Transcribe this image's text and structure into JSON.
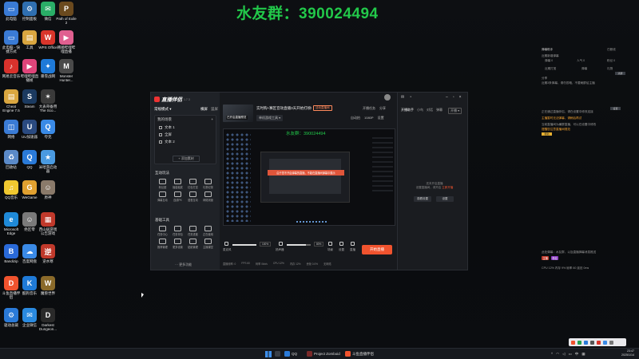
{
  "watermark": "水友群：390024494",
  "desktop_icons": [
    {
      "label": "此电脑",
      "color": "#3a7bd5",
      "glyph": "▭"
    },
    {
      "label": "控制面板",
      "color": "#2f6fb0",
      "glyph": "⚙"
    },
    {
      "label": "微信",
      "color": "#2aae67",
      "glyph": "✉"
    },
    {
      "label": "Path of Exile 2",
      "color": "#6b4a1e",
      "glyph": "P"
    },
    {
      "label": "此电脑 - 快捷方式",
      "color": "#3a7bd5",
      "glyph": "▭"
    },
    {
      "label": "工具",
      "color": "#d9a640",
      "glyph": "▤"
    },
    {
      "label": "WPS Office",
      "color": "#d9352b",
      "glyph": "W"
    },
    {
      "label": "韩顺哔哩哔哩直播",
      "color": "#e06090",
      "glyph": "▶"
    },
    {
      "label": "网易云音乐",
      "color": "#d8322c",
      "glyph": "♪"
    },
    {
      "label": "哔哩哔哩直播姬",
      "color": "#e0457a",
      "glyph": "▶"
    },
    {
      "label": "暴雪战网",
      "color": "#1f7ad8",
      "glyph": "✦"
    },
    {
      "label": "Monster Hunter...",
      "color": "#4a4a4a",
      "glyph": "M"
    },
    {
      "label": "Cheat Engine 7.5",
      "color": "#d9a640",
      "glyph": "▤"
    },
    {
      "label": "Steam",
      "color": "#1b3a60",
      "glyph": "S"
    },
    {
      "label": "大表哥备用The Sco...",
      "color": "#3a3a3a",
      "glyph": "✶"
    },
    {
      "label": "网络",
      "color": "#3a7bd5",
      "glyph": "◫"
    },
    {
      "label": "UU加速器",
      "color": "#2a4a80",
      "glyph": "U"
    },
    {
      "label": "夸克",
      "color": "#3a8ae6",
      "glyph": "Q"
    },
    {
      "label": "回收站",
      "color": "#5b8ac8",
      "glyph": "♻"
    },
    {
      "label": "QQ",
      "color": "#2a7ad8",
      "glyph": "Q"
    },
    {
      "label": "米哈游启动器",
      "color": "#4a9ae0",
      "glyph": "★"
    },
    {
      "label": "QQ音乐",
      "color": "#f0c830",
      "glyph": "♫"
    },
    {
      "label": "WeGame",
      "color": "#e0a030",
      "glyph": "G"
    },
    {
      "label": "原神",
      "color": "#8a7a6a",
      "glyph": "☺"
    },
    {
      "label": "Microsoft Edge",
      "color": "#1f8ad8",
      "glyph": "e"
    },
    {
      "label": "绝区零",
      "color": "#7a7a7a",
      "glyph": "☺"
    },
    {
      "label": "西山居游戏 公告游戏",
      "color": "#c0392b",
      "glyph": "▦"
    },
    {
      "label": "Bandizip",
      "color": "#2a6ad8",
      "glyph": "B"
    },
    {
      "label": "百度网盘",
      "color": "#3a8ae6",
      "glyph": "☁"
    },
    {
      "label": "逆水寒",
      "color": "#c0392b",
      "glyph": "逆"
    },
    {
      "label": "斗鱼直播伴侣",
      "color": "#f0532e",
      "glyph": "D"
    },
    {
      "label": "酷狗音乐",
      "color": "#1f7ad8",
      "glyph": "K"
    },
    {
      "label": "魔兽世界",
      "color": "#8a6a2a",
      "glyph": "W"
    },
    {
      "label": "驱动总裁",
      "color": "#2a7ad8",
      "glyph": "⚙"
    },
    {
      "label": "企业微信",
      "color": "#2a8ae0",
      "glyph": "✉"
    },
    {
      "label": "Darkest Dungeon...",
      "color": "#2a2a2a",
      "glyph": "D"
    }
  ],
  "app": {
    "logo_text": "直播伴侣",
    "version": "1.7.3",
    "mode_label": "常规模式 ▾",
    "mode_tabs": [
      "横屏",
      "竖屏"
    ],
    "scene_header": "我的场景",
    "scenes": [
      "文本 1",
      "全屏",
      "文本 2"
    ],
    "add_source": "+ 添加素材",
    "section_interactive": "互动玩法",
    "interactive_tools": [
      "粉丝团",
      "福袋抽奖",
      "红包打赏",
      "礼物记录",
      "弹幕互动",
      "连线PK",
      "语音互动",
      "网络测速"
    ],
    "section_basic": "基础工具",
    "basic_tools": [
      "任务中心",
      "任务背包",
      "任务进度",
      "正在使用",
      "推荐管理",
      "更多设置",
      "贴纸管理",
      "主播课堂"
    ],
    "more_functions": "··· 更多功能",
    "thumb_caption": "已开启直播预览",
    "stream_title": "实时购+赛区音效直播3天开始打榜!",
    "stream_tag": "活动直播间",
    "category": "单机游戏工具 ▾",
    "top_actions": [
      "开播任务",
      "分享"
    ],
    "top_actions2": [
      "自动拍",
      "1080P",
      "设置"
    ],
    "preview_watermark": "水友群：390024494",
    "preview_banner": "由于您不开启弹幕的直播，不能在直播间弹幕中展示",
    "control_labels": [
      "麦克风",
      "扬声器",
      "场景",
      "设置",
      "直播"
    ],
    "mic_pct": "100%",
    "speaker_pct": "80%",
    "start_live": "开始直播",
    "status_items": [
      "直播帧率: 0",
      "FPS 60",
      "码率 0kb/s",
      "CPU 12%",
      "内存 12%",
      "丢帧 0.0%",
      "无网络"
    ],
    "side_tabs": [
      "开播助手",
      "小鸟",
      "对话",
      "弹幕"
    ],
    "side_pill": "开播 ▾",
    "side_empty_line1": "还未开启直播",
    "side_empty_line2": "设置直播间，请开启",
    "side_empty_link": "立即开播",
    "side_buttons": [
      "观看设置",
      "设置"
    ]
  },
  "overlay": {
    "head": "弹幕助手",
    "head_right": "已断线",
    "lines": [
      "近期新增弹幕",
      "弹幕 0",
      "人气 0",
      "粉丝 0",
      "近期打赏",
      "弹幕",
      "礼物",
      "分享",
      "近期3条弹幕，请勿忽略，不要刷屏给主播",
      "正在通过直播伴侣，请在设置中修改连接",
      "当前直播间为横屏直播，可以在设置中修改"
    ],
    "warn1": "主播暂时无法弹幕，请稍后再试",
    "warn2": "提醒您注意直播间规范",
    "buttons": [
      "清屏",
      "设置",
      "帮助"
    ],
    "footer": "此处弹幕：水友群，以及直播弹幕消息推送",
    "badge1": "主播",
    "badge2": "粉丝",
    "stat_line": "CPU 12%  内存 9%  帧率 60  延迟 0ms"
  },
  "taskbar": {
    "items": [
      "QQ",
      "Project Zomboid",
      "斗鱼直播伴侣"
    ],
    "time": "23:47",
    "date": "2025/1/14"
  },
  "colors": {
    "watermark": "#22c84a",
    "accent": "#f0532e",
    "app_bg": "#17191d"
  }
}
